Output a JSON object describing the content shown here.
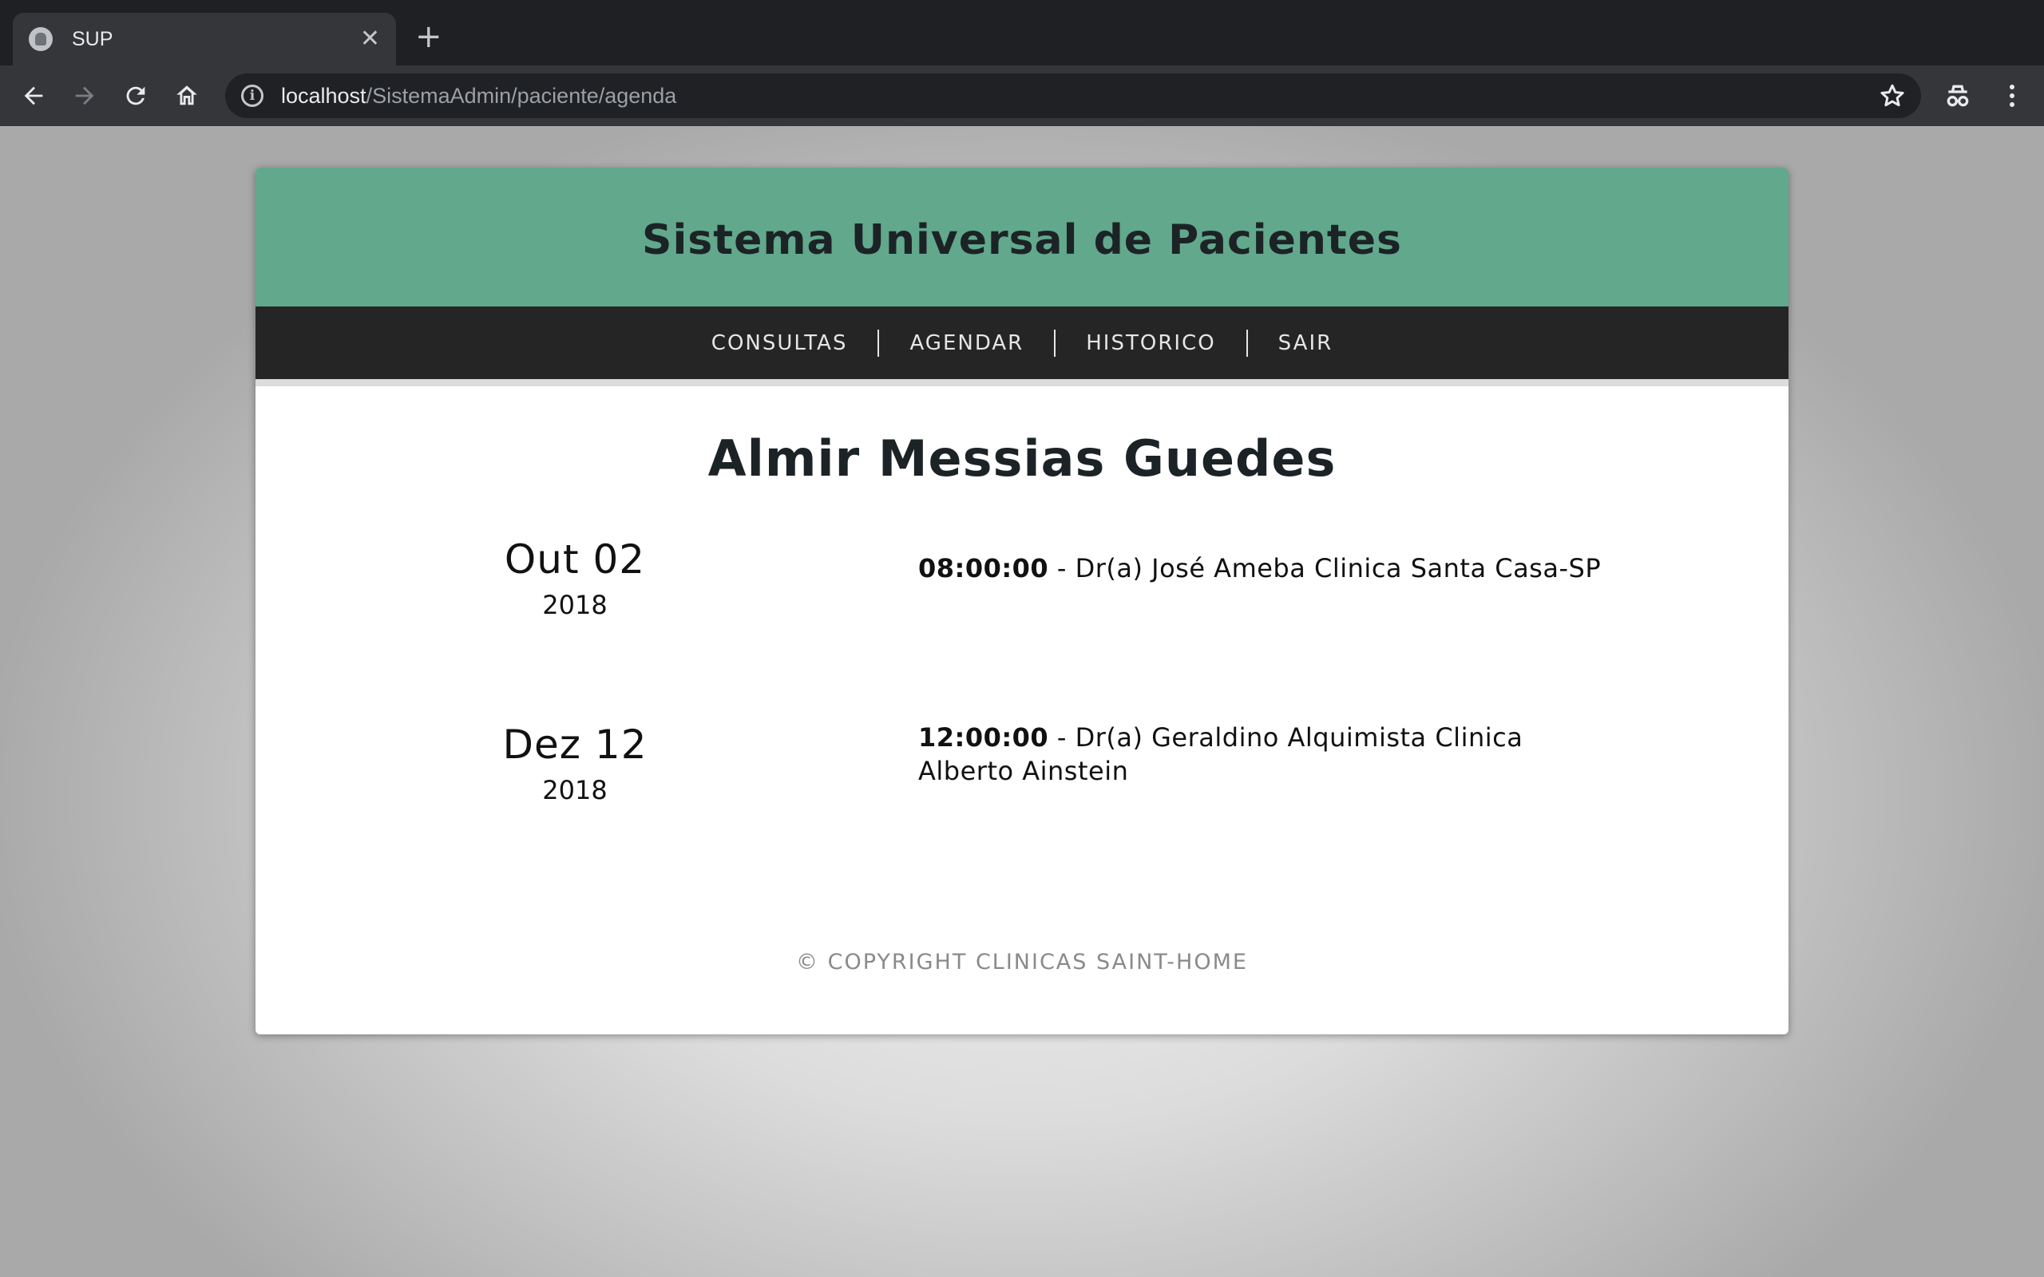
{
  "browser": {
    "tab_title": "SUP",
    "url_host": "localhost",
    "url_path": "/SistemaAdmin/paciente/agenda"
  },
  "site": {
    "title": "Sistema Universal de Pacientes",
    "nav": [
      {
        "label": "CONSULTAS"
      },
      {
        "label": "AGENDAR"
      },
      {
        "label": "HISTORICO"
      },
      {
        "label": "SAIR"
      }
    ]
  },
  "patient": {
    "name": "Almir Messias Guedes"
  },
  "appointments": [
    {
      "day_month": "Out 02",
      "year": "2018",
      "time": "08:00:00",
      "details": " - Dr(a) José Ameba Clinica Santa Casa-SP"
    },
    {
      "day_month": "Dez 12",
      "year": "2018",
      "time": "12:00:00",
      "details": " - Dr(a) Geraldino Alquimista Clinica Alberto Ainstein"
    }
  ],
  "footer": {
    "copyright": "© COPYRIGHT CLINICAS SAINT-HOME"
  },
  "colors": {
    "header_green": "#62a88c",
    "nav_dark": "#252525"
  },
  "icons": [
    "favicon-icon",
    "close-icon",
    "new-tab-icon",
    "back-icon",
    "forward-icon",
    "reload-icon",
    "home-icon",
    "info-icon",
    "star-icon",
    "extension-icon",
    "menu-icon"
  ]
}
